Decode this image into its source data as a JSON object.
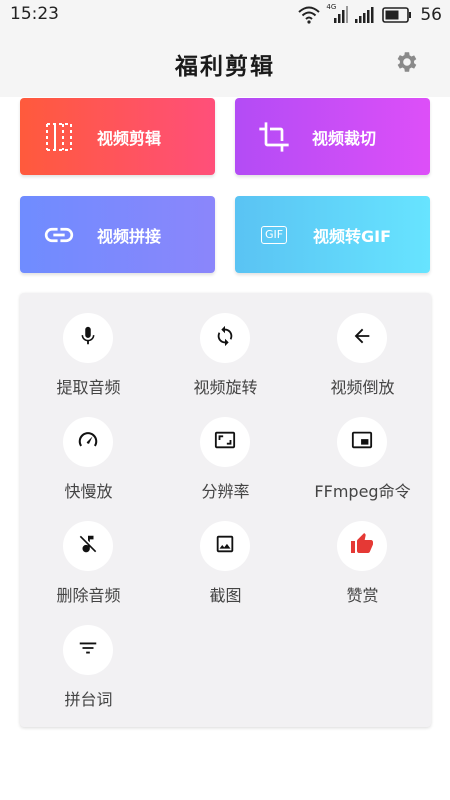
{
  "status_bar": {
    "time": "15:23",
    "battery": "56",
    "network_badge": "4G",
    "icons": [
      "wifi-icon",
      "signal-icon",
      "battery-icon"
    ]
  },
  "header": {
    "title": "福利剪辑",
    "settings_icon": "gear-icon"
  },
  "feature_cards": [
    {
      "label": "视频剪辑",
      "icon": "trim-icon",
      "color_start": "#ff5a3c",
      "color_end": "#ff4f7a"
    },
    {
      "label": "视频裁切",
      "icon": "crop-icon",
      "color_start": "#b34cf5",
      "color_end": "#dd4ff8"
    },
    {
      "label": "视频拼接",
      "icon": "link-icon",
      "color_start": "#6f8cff",
      "color_end": "#8b86fb"
    },
    {
      "label": "视频转GIF",
      "icon": "gif-icon",
      "icon_text": "GIF",
      "color_start": "#5ac3f3",
      "color_end": "#67e4ff"
    }
  ],
  "tools": [
    {
      "label": "提取音频",
      "icon": "mic-icon"
    },
    {
      "label": "视频旋转",
      "icon": "rotate-icon"
    },
    {
      "label": "视频倒放",
      "icon": "arrow-left-icon"
    },
    {
      "label": "快慢放",
      "icon": "speedometer-icon"
    },
    {
      "label": "分辨率",
      "icon": "aspect-ratio-icon"
    },
    {
      "label": "FFmpeg命令",
      "icon": "picture-in-picture-icon"
    },
    {
      "label": "删除音频",
      "icon": "music-off-icon"
    },
    {
      "label": "截图",
      "icon": "image-icon"
    },
    {
      "label": "赞赏",
      "icon": "thumbs-up-icon",
      "icon_color": "#e53935"
    },
    {
      "label": "拼台词",
      "icon": "filter-lines-icon"
    }
  ],
  "colors": {
    "panel_bg": "#f2f1f3",
    "header_bg": "#f5f5f5"
  }
}
